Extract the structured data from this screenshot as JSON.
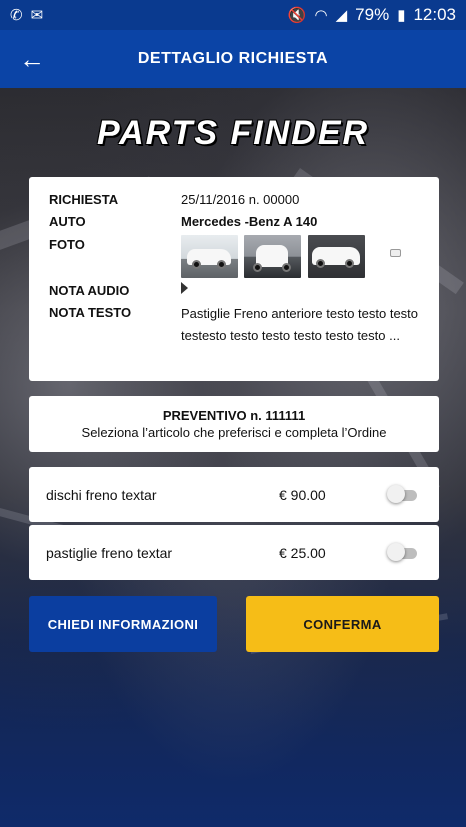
{
  "status_bar": {
    "battery": "79%",
    "time": "12:03",
    "icons": [
      "whatsapp-icon",
      "mail-icon",
      "mute-icon",
      "wifi-icon",
      "signal-icon",
      "battery-icon"
    ]
  },
  "app_bar": {
    "title": "DETTAGLIO RICHIESTA",
    "back_icon": "←"
  },
  "logo": {
    "text": "PARTS FINDER"
  },
  "request": {
    "labels": {
      "richiesta": "RICHIESTA",
      "auto": "AUTO",
      "foto": "FOTO",
      "nota_audio": "NOTA AUDIO",
      "nota_testo": "NOTA TESTO"
    },
    "richiesta_value": "25/11/2016 n. 00000",
    "auto_value": "Mercedes -Benz A 140",
    "note_text": "Pastiglie Freno anteriore  testo testo testo testesto testo testo testo testo testo ..."
  },
  "quote": {
    "title": "PREVENTIVO n. 111111",
    "subtitle": "Seleziona l’articolo che preferisci e completa l’Ordine"
  },
  "items": [
    {
      "name": "dischi freno textar",
      "price": "€ 90.00",
      "selected": false
    },
    {
      "name": "pastiglie freno textar",
      "price": "€ 25.00",
      "selected": false
    }
  ],
  "buttons": {
    "info": "CHIEDI INFORMAZIONI",
    "confirm": "CONFERMA"
  },
  "colors": {
    "app_bar": "#0b44a6",
    "status_bar": "#0a3a8f",
    "info_button": "#0b3ea0",
    "confirm_button": "#f6bd17"
  }
}
